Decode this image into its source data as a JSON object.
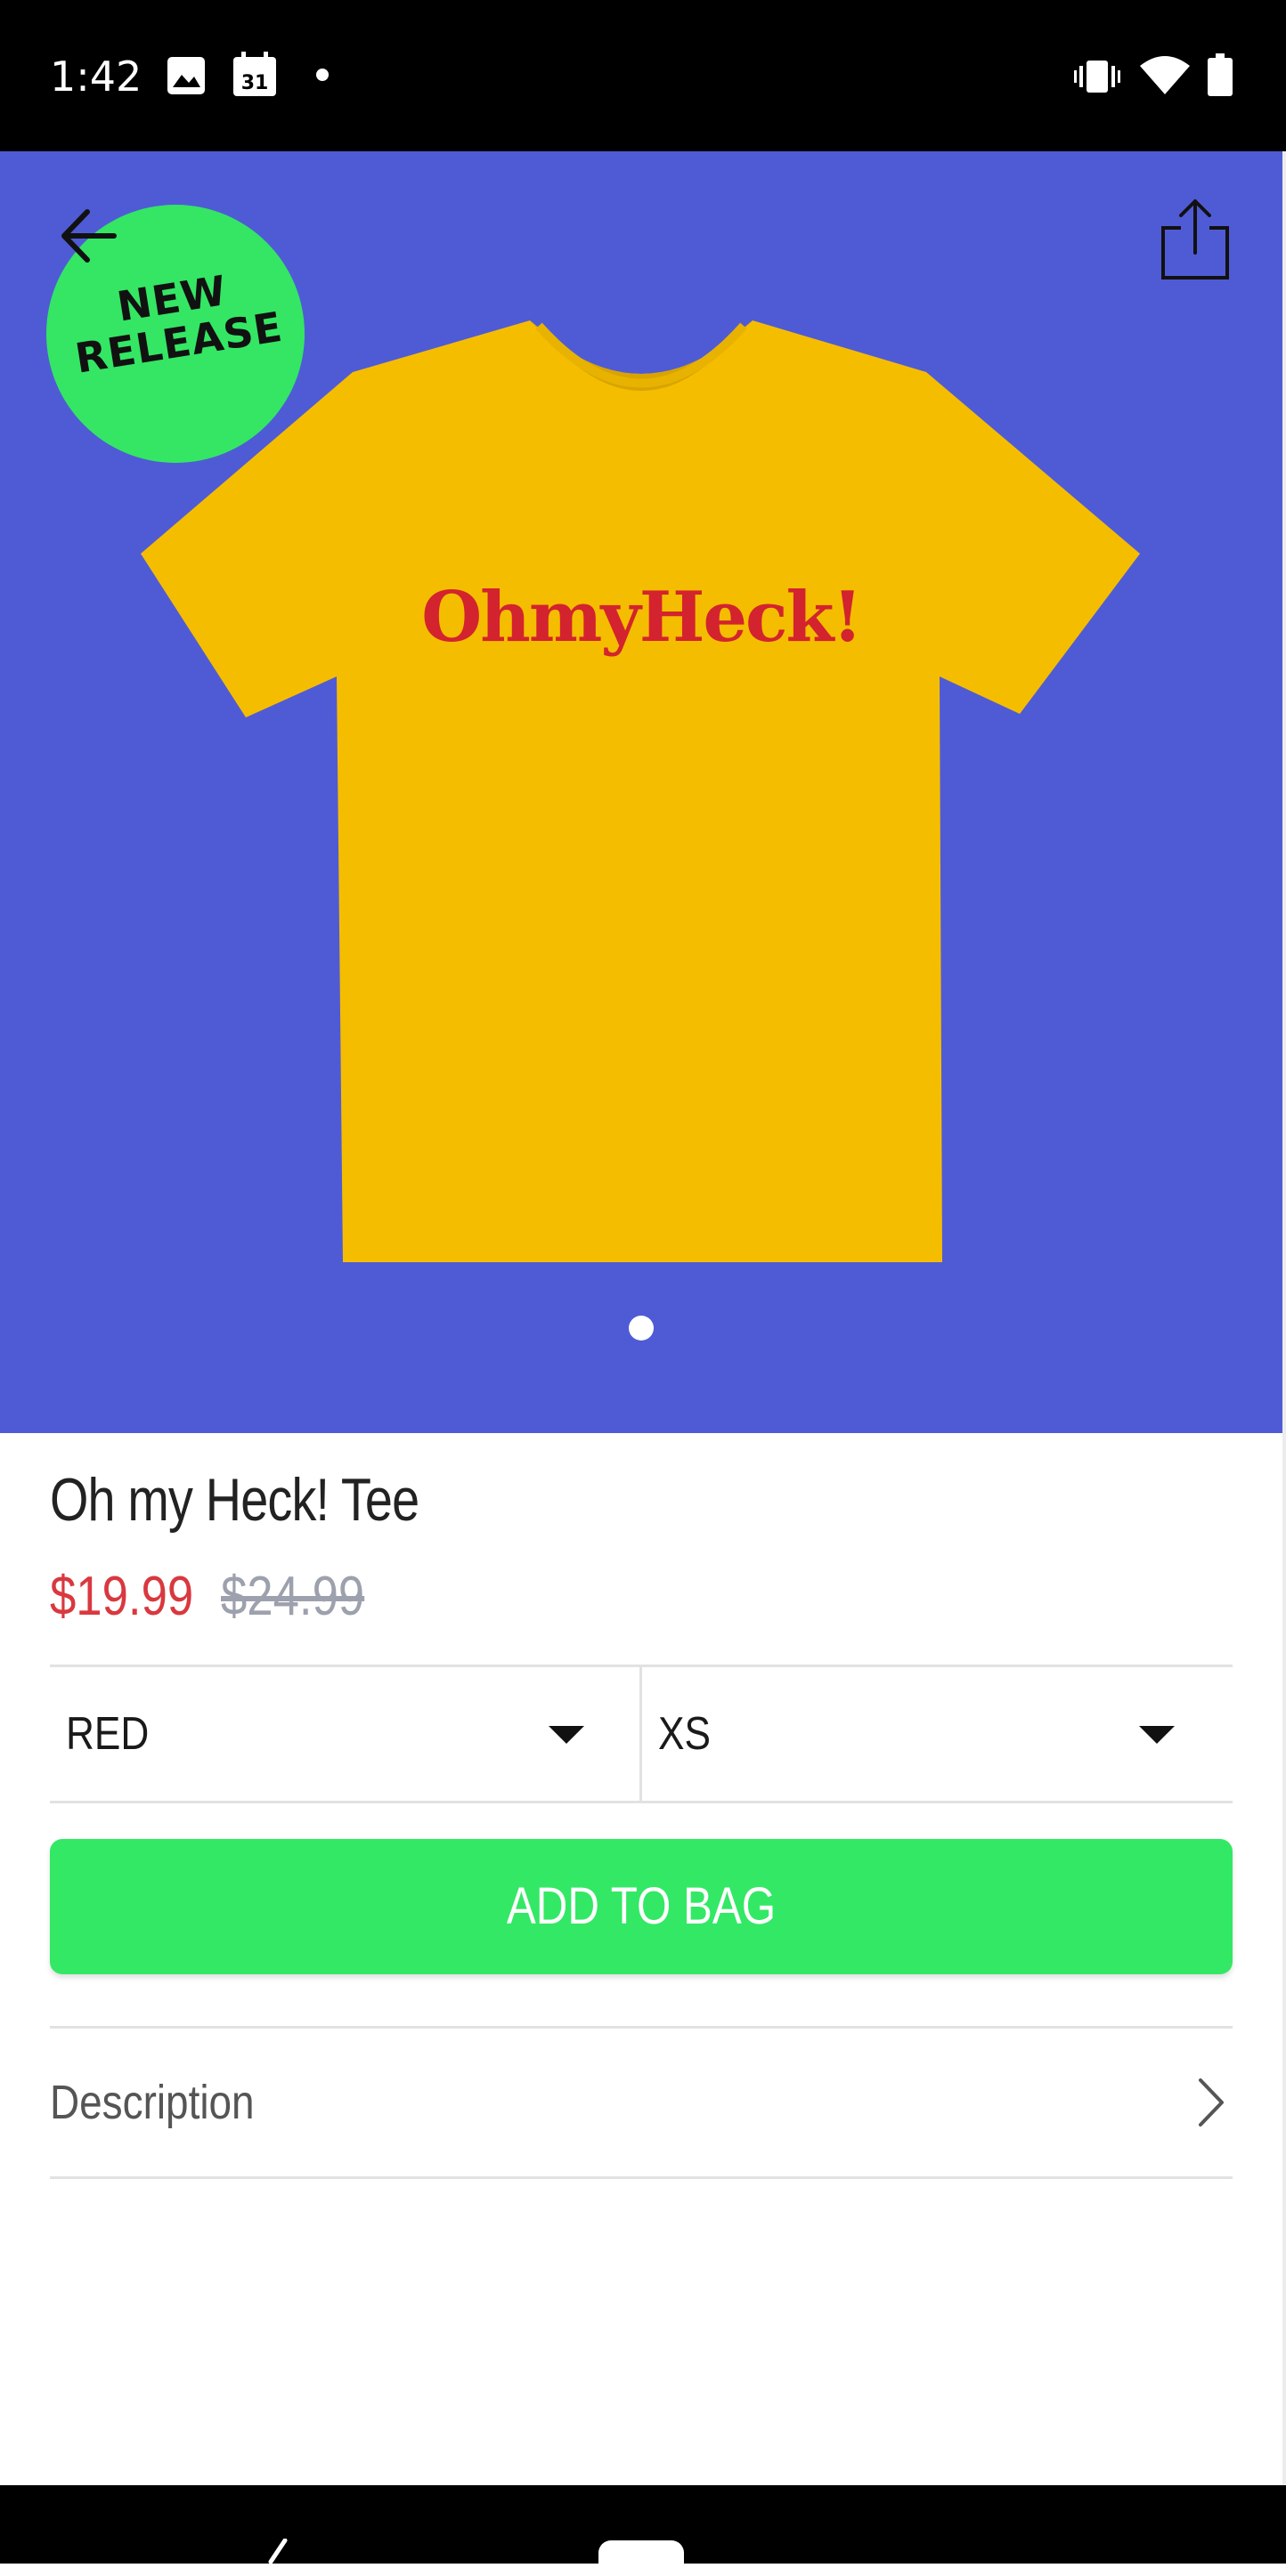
{
  "status_bar": {
    "time": "1:42",
    "calendar_day": "31",
    "icons": [
      "image-icon",
      "calendar-icon",
      "notification-dot",
      "vibrate-icon",
      "wifi-icon",
      "battery-icon"
    ]
  },
  "hero": {
    "background_color": "#4f5bd5",
    "badge": {
      "line1": "NEW",
      "line2": "RELEASE",
      "color": "#34e664"
    },
    "tee": {
      "color": "#f5bd00",
      "print_text": "OhmyHeck!",
      "print_color": "#d3232e"
    },
    "carousel": {
      "count": 1,
      "active": 0
    }
  },
  "product": {
    "title": "Oh my Heck! Tee",
    "sale_price": "$19.99",
    "original_price": "$24.99"
  },
  "options": {
    "color": {
      "selected": "RED"
    },
    "size": {
      "selected": "XS"
    }
  },
  "actions": {
    "add_to_bag": "ADD TO BAG",
    "button_color": "#33e865"
  },
  "sections": {
    "description": "Description"
  }
}
